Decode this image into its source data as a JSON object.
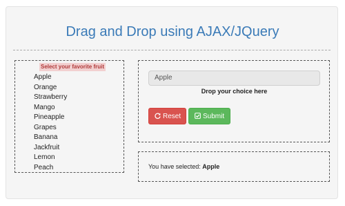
{
  "header": {
    "title": "Drag and Drop using AJAX/JQuery"
  },
  "left": {
    "label": "Select your favorite fruit",
    "fruits": [
      "Apple",
      "Orange",
      "Strawberry",
      "Mango",
      "Pineapple",
      "Grapes",
      "Banana",
      "Jackfruit",
      "Lemon",
      "Peach"
    ]
  },
  "drop": {
    "value": "Apple",
    "caption": "Drop your choice here"
  },
  "buttons": {
    "reset_label": "Reset",
    "submit_label": "Submit",
    "reset_icon": "refresh-icon",
    "submit_icon": "check-square-icon"
  },
  "result": {
    "prefix": "You have selected: ",
    "value": "Apple"
  },
  "colors": {
    "title": "#3a7ab7",
    "reset": "#d9534f",
    "submit": "#5cb85c",
    "label_bg": "#f2d0d0",
    "label_text": "#b03a3a"
  }
}
